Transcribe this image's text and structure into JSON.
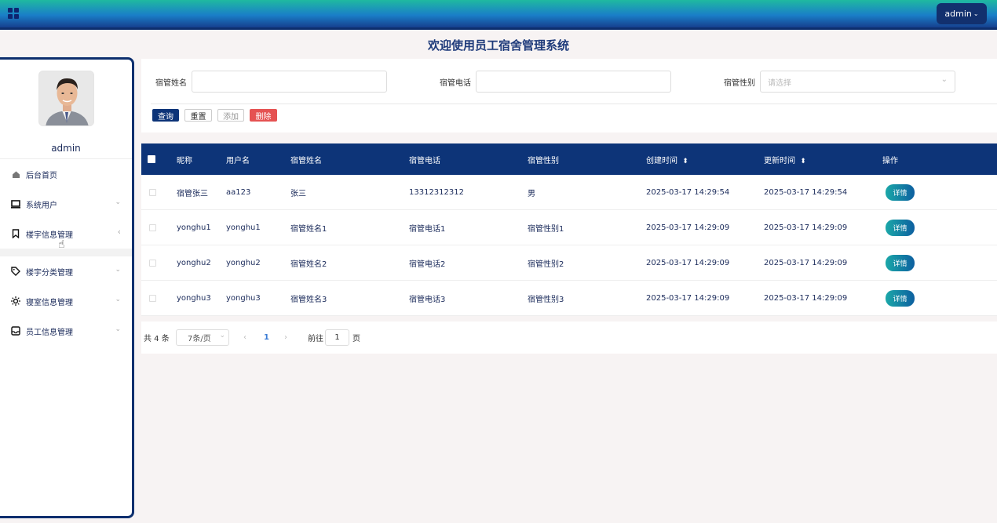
{
  "header": {
    "welcome": "欢迎使用员工宿舍管理系统",
    "user_label": "admin",
    "menu_icon": "grid-icon"
  },
  "sidebar": {
    "username": "admin",
    "items": [
      {
        "label": "后台首页",
        "icon": "home-icon"
      },
      {
        "label": "系统用户",
        "icon": "monitor-icon"
      },
      {
        "label": "楼宇信息管理",
        "icon": "bookmark-icon"
      },
      {
        "label": "楼宇分类管理",
        "icon": "tag-icon"
      },
      {
        "label": "寝室信息管理",
        "icon": "sun-icon"
      },
      {
        "label": "员工信息管理",
        "icon": "inbox-icon"
      }
    ]
  },
  "search": {
    "name_label": "宿管姓名",
    "name_value": "",
    "phone_label": "宿管电话",
    "phone_value": "",
    "gender_label": "宿管性别",
    "gender_placeholder": "请选择",
    "query_btn": "查询",
    "reset_btn": "重置",
    "add_btn": "添加",
    "delete_btn": "删除"
  },
  "table": {
    "columns": [
      "昵称",
      "用户名",
      "宿管姓名",
      "宿管电话",
      "宿管性别",
      "创建时间",
      "更新时间",
      "操作"
    ],
    "sort_icon": "⬍",
    "detail_label": "详情",
    "rows": [
      {
        "nick": "宿管张三",
        "user": "aa123",
        "name": "张三",
        "phone": "13312312312",
        "gender": "男",
        "created": "2025-03-17 14:29:54",
        "updated": "2025-03-17 14:29:54"
      },
      {
        "nick": "yonghu1",
        "user": "yonghu1",
        "name": "宿管姓名1",
        "phone": "宿管电话1",
        "gender": "宿管性别1",
        "created": "2025-03-17 14:29:09",
        "updated": "2025-03-17 14:29:09"
      },
      {
        "nick": "yonghu2",
        "user": "yonghu2",
        "name": "宿管姓名2",
        "phone": "宿管电话2",
        "gender": "宿管性别2",
        "created": "2025-03-17 14:29:09",
        "updated": "2025-03-17 14:29:09"
      },
      {
        "nick": "yonghu3",
        "user": "yonghu3",
        "name": "宿管姓名3",
        "phone": "宿管电话3",
        "gender": "宿管性别3",
        "created": "2025-03-17 14:29:09",
        "updated": "2025-03-17 14:29:09"
      }
    ]
  },
  "pagination": {
    "total": "共 4 条",
    "page_size": "7条/页",
    "current_page": "1",
    "goto_label": "前往",
    "goto_value": "1",
    "page_suffix": "页"
  },
  "colors": {
    "primary": "#0d3478",
    "danger": "#e55252",
    "accent": "#1ba8a8"
  }
}
